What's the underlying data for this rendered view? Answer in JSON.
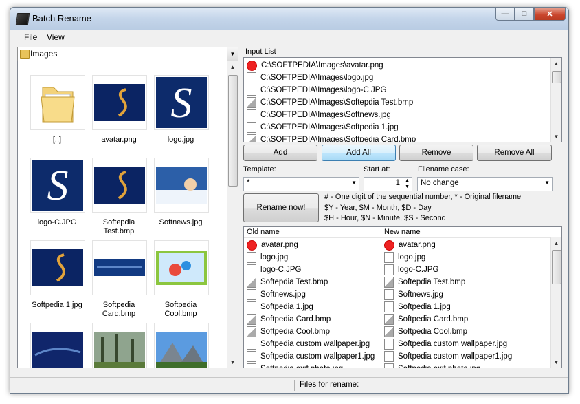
{
  "window": {
    "title": "Batch Rename"
  },
  "menu": [
    "File",
    "View"
  ],
  "folder": {
    "name": "Images"
  },
  "thumbnails": [
    {
      "caption": "[..]",
      "kind": "folder"
    },
    {
      "caption": "avatar.png",
      "kind": "avatar"
    },
    {
      "caption": "logo.jpg",
      "kind": "logo"
    },
    {
      "caption": "logo-C.JPG",
      "kind": "logo"
    },
    {
      "caption": "Softepdia Test.bmp",
      "kind": "avatar"
    },
    {
      "caption": "Softnews.jpg",
      "kind": "softnews"
    },
    {
      "caption": "Softpedia 1.jpg",
      "kind": "avatar"
    },
    {
      "caption": "Softpedia Card.bmp",
      "kind": "card"
    },
    {
      "caption": "Softpedia Cool.bmp",
      "kind": "cool"
    },
    {
      "caption": "",
      "kind": "blue"
    },
    {
      "caption": "",
      "kind": "forest"
    },
    {
      "caption": "",
      "kind": "mountain"
    }
  ],
  "input_list": {
    "label": "Input List",
    "items": [
      {
        "path": "C:\\SOFTPEDIA\\Images\\avatar.png",
        "icon": "red"
      },
      {
        "path": "C:\\SOFTPEDIA\\Images\\logo.jpg",
        "icon": "doc"
      },
      {
        "path": "C:\\SOFTPEDIA\\Images\\logo-C.JPG",
        "icon": "doc"
      },
      {
        "path": "C:\\SOFTPEDIA\\Images\\Softepdia Test.bmp",
        "icon": "bmp"
      },
      {
        "path": "C:\\SOFTPEDIA\\Images\\Softnews.jpg",
        "icon": "doc"
      },
      {
        "path": "C:\\SOFTPEDIA\\Images\\Softpedia 1.jpg",
        "icon": "doc"
      },
      {
        "path": "C:\\SOFTPEDIA\\Images\\Softpedia Card.bmp",
        "icon": "bmp"
      }
    ]
  },
  "buttons": {
    "add": "Add",
    "add_all": "Add All",
    "remove": "Remove",
    "remove_all": "Remove All",
    "rename": "Rename now!"
  },
  "template": {
    "label": "Template:",
    "value": "*"
  },
  "start_at": {
    "label": "Start at:",
    "value": "1"
  },
  "filename_case": {
    "label": "Filename case:",
    "value": "No change"
  },
  "help": [
    "# - One digit of the sequential number, * - Original filename",
    "$Y - Year, $M - Month, $D - Day",
    "$H - Hour, $N - Minute, $S - Second"
  ],
  "rename_table": {
    "old_header": "Old name",
    "new_header": "New name",
    "rows": [
      {
        "old": "avatar.png",
        "new": "avatar.png",
        "icon": "red"
      },
      {
        "old": "logo.jpg",
        "new": "logo.jpg",
        "icon": "doc"
      },
      {
        "old": "logo-C.JPG",
        "new": "logo-C.JPG",
        "icon": "doc"
      },
      {
        "old": "Softepdia Test.bmp",
        "new": "Softepdia Test.bmp",
        "icon": "bmp"
      },
      {
        "old": "Softnews.jpg",
        "new": "Softnews.jpg",
        "icon": "doc"
      },
      {
        "old": "Softpedia 1.jpg",
        "new": "Softpedia 1.jpg",
        "icon": "doc"
      },
      {
        "old": "Softpedia Card.bmp",
        "new": "Softpedia Card.bmp",
        "icon": "bmp"
      },
      {
        "old": "Softpedia Cool.bmp",
        "new": "Softpedia Cool.bmp",
        "icon": "bmp"
      },
      {
        "old": "Softpedia custom wallpaper.jpg",
        "new": "Softpedia custom wallpaper.jpg",
        "icon": "doc"
      },
      {
        "old": "Softpedia custom wallpaper1.jpg",
        "new": "Softpedia custom wallpaper1.jpg",
        "icon": "doc"
      },
      {
        "old": "Softpedia exif photo.jpg",
        "new": "Softpedia exif photo.jpg",
        "icon": "doc"
      }
    ]
  },
  "status": {
    "files_label": "Files for rename:"
  }
}
